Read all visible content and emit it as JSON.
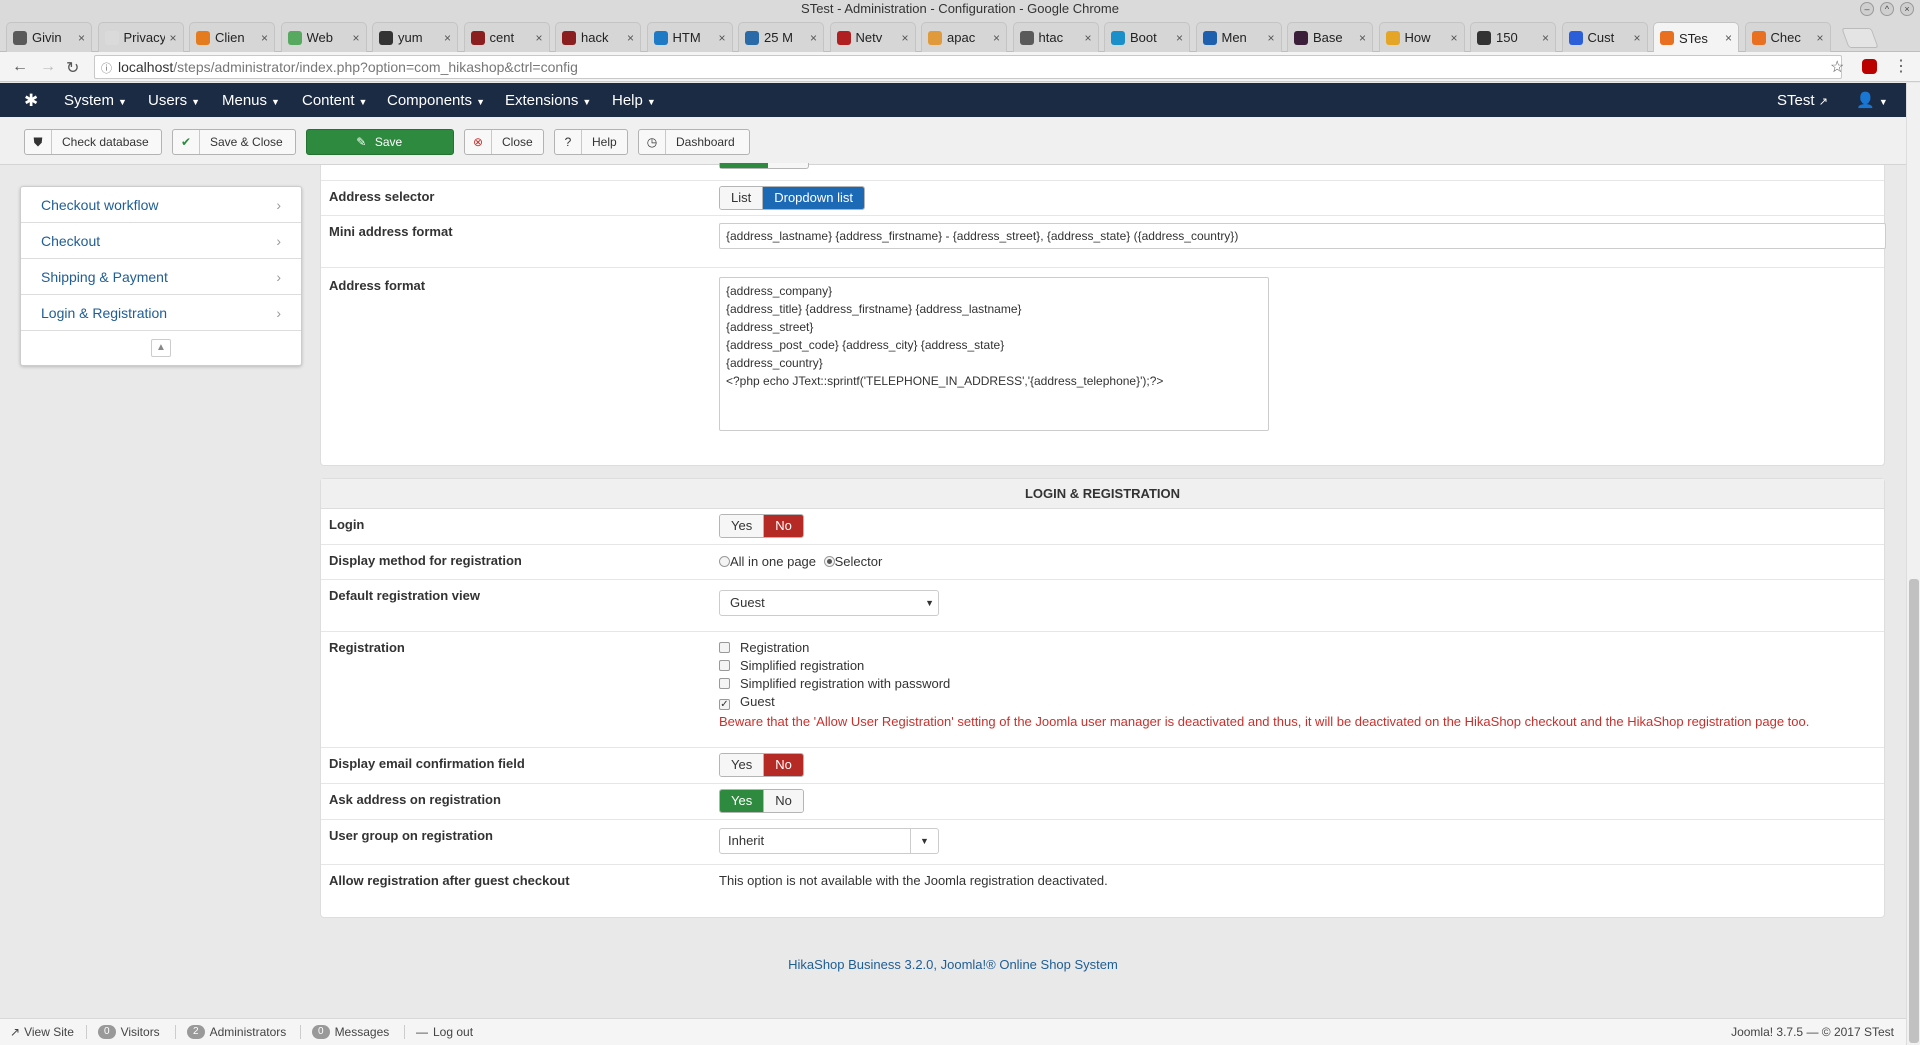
{
  "window": {
    "title": "STest - Administration - Configuration - Google Chrome"
  },
  "tabs": [
    {
      "label": "Givin",
      "color": "#5a5a5a"
    },
    {
      "label": "Privacy",
      "color": "#dadada"
    },
    {
      "label": "Clien",
      "color": "#e47c1f"
    },
    {
      "label": "Web",
      "color": "#56a95f"
    },
    {
      "label": "yum",
      "color": "#333333"
    },
    {
      "label": "cent",
      "color": "#8b1e1e"
    },
    {
      "label": "hack",
      "color": "#8b1e1e"
    },
    {
      "label": "HTM",
      "color": "#1f7ac5"
    },
    {
      "label": "25 M",
      "color": "#2a6aa8"
    },
    {
      "label": "Netv",
      "color": "#b02020"
    },
    {
      "label": "apac",
      "color": "#e09a3c"
    },
    {
      "label": "htac",
      "color": "#5a5a5a"
    },
    {
      "label": "Boot",
      "color": "#1a8fc9"
    },
    {
      "label": "Men",
      "color": "#1e5fae"
    },
    {
      "label": "Base",
      "color": "#3b1f3a"
    },
    {
      "label": "How",
      "color": "#e5a526"
    },
    {
      "label": "150",
      "color": "#333333"
    },
    {
      "label": "Cust",
      "color": "#2b5fd9"
    },
    {
      "label": "STes",
      "color": "#e96f21"
    },
    {
      "label": "Chec",
      "color": "#e96f21"
    }
  ],
  "address_bar": {
    "host": "localhost",
    "path": "/steps/administrator/index.php?option=com_hikashop&ctrl=config"
  },
  "joomla_nav": {
    "menus": [
      "System",
      "Users",
      "Menus",
      "Content",
      "Components",
      "Extensions",
      "Help"
    ],
    "site_link": "STest"
  },
  "toolbar": {
    "check_database": "Check database",
    "save_close": "Save & Close",
    "save": "Save",
    "close": "Close",
    "help": "Help",
    "dashboard": "Dashboard"
  },
  "sidebar": {
    "items": [
      "Checkout workflow",
      "Checkout",
      "Shipping & Payment",
      "Login & Registration"
    ]
  },
  "address_section": {
    "address_selector": {
      "label": "Address selector",
      "options": [
        "List",
        "Dropdown list"
      ],
      "selected": "Dropdown list"
    },
    "mini_address_format": {
      "label": "Mini address format",
      "value": "{address_lastname} {address_firstname} - {address_street}, {address_state} ({address_country})"
    },
    "address_format": {
      "label": "Address format",
      "value": "{address_company}\n{address_title} {address_firstname} {address_lastname}\n{address_street}\n{address_post_code} {address_city} {address_state}\n{address_country}\n<?php echo JText::sprintf('TELEPHONE_IN_ADDRESS','{address_telephone}');?>"
    }
  },
  "login_registration": {
    "heading": "LOGIN & REGISTRATION",
    "login": {
      "label": "Login",
      "yes": "Yes",
      "no": "No",
      "selected": "No"
    },
    "display_method": {
      "label": "Display method for registration",
      "options": [
        "All in one page",
        "Selector"
      ],
      "selected": "Selector"
    },
    "default_view": {
      "label": "Default registration view",
      "value": "Guest"
    },
    "registration": {
      "label": "Registration",
      "options": [
        {
          "text": "Registration",
          "checked": false
        },
        {
          "text": "Simplified registration",
          "checked": false
        },
        {
          "text": "Simplified registration with password",
          "checked": false
        },
        {
          "text": "Guest",
          "checked": true
        }
      ],
      "warning": "Beware that the 'Allow User Registration' setting of the Joomla user manager is deactivated and thus, it will be deactivated on the HikaShop checkout and the HikaShop registration page too."
    },
    "email_confirmation": {
      "label": "Display email confirmation field",
      "yes": "Yes",
      "no": "No",
      "selected": "No"
    },
    "ask_address": {
      "label": "Ask address on registration",
      "yes": "Yes",
      "no": "No",
      "selected": "Yes"
    },
    "user_group": {
      "label": "User group on registration",
      "value": "Inherit"
    },
    "allow_after_guest": {
      "label": "Allow registration after guest checkout",
      "value": "This option is not available with the Joomla registration deactivated."
    }
  },
  "footer": {
    "link": "HikaShop Business 3.2.0, Joomla!® Online Shop System"
  },
  "statusbar": {
    "view_site": "View Site",
    "visitors_count": "0",
    "visitors": "Visitors",
    "admins_count": "2",
    "admins": "Administrators",
    "messages_count": "0",
    "messages": "Messages",
    "logout": "Log out",
    "copyright": "Joomla! 3.7.5 — © 2017 STest"
  }
}
